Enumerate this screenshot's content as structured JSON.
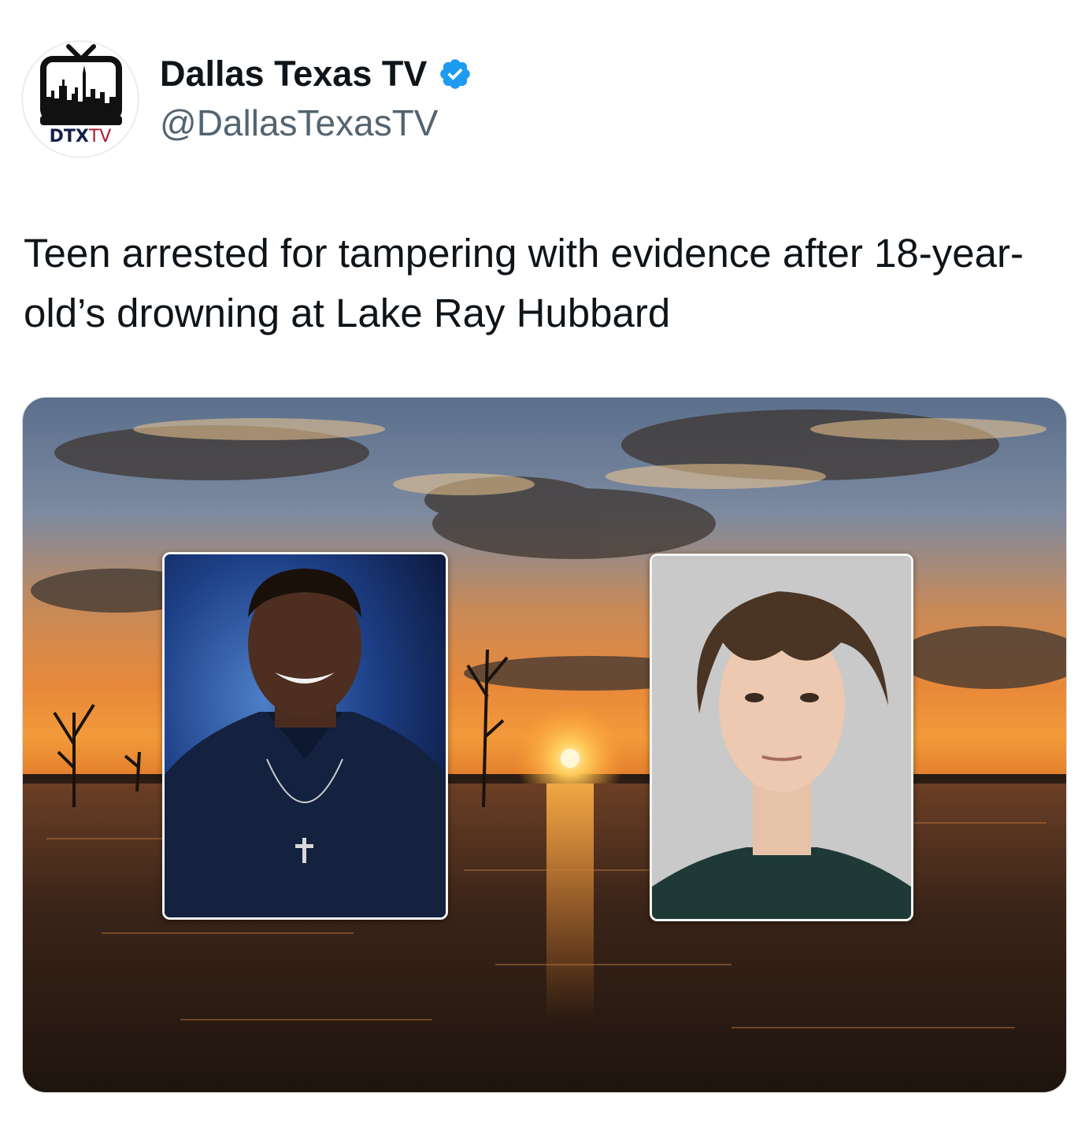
{
  "account": {
    "display_name": "Dallas Texas TV",
    "handle": "@DallasTexasTV",
    "verified": true,
    "verified_color": "#1d9bf0",
    "avatar": {
      "icon": "tv-skyline-logo-icon",
      "logo_text": "DTXTV"
    }
  },
  "tweet": {
    "text": "Teen arrested for tampering with evidence after 18-year-old’s drowning at Lake Ray Hubbard"
  },
  "media": {
    "scene": "lake-sunset-image",
    "photos": [
      {
        "name": "portrait-photo-left"
      },
      {
        "name": "mugshot-photo-right"
      }
    ]
  }
}
